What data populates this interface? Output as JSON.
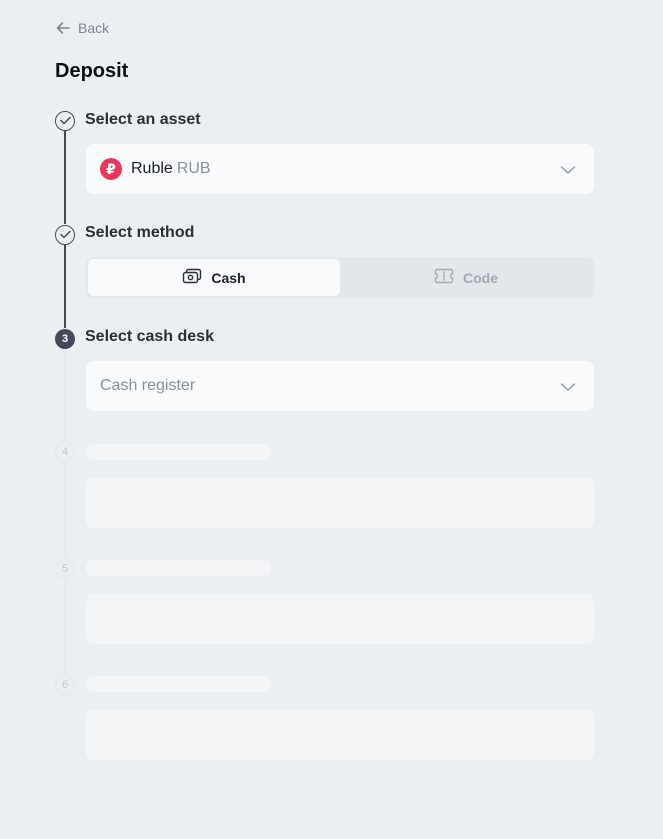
{
  "nav": {
    "back_label": "Back"
  },
  "page": {
    "title": "Deposit"
  },
  "steps": {
    "asset": {
      "label": "Select an asset",
      "currency_symbol": "₽",
      "asset_name": "Ruble",
      "asset_code": "RUB"
    },
    "method": {
      "label": "Select method",
      "options": [
        {
          "label": "Cash",
          "selected": true
        },
        {
          "label": "Code",
          "selected": false
        }
      ]
    },
    "cash_desk": {
      "number": "3",
      "label": "Select cash desk",
      "placeholder": "Cash register"
    },
    "pending": [
      {
        "number": "4"
      },
      {
        "number": "5"
      },
      {
        "number": "6"
      }
    ]
  },
  "colors": {
    "background": "#eceff2",
    "card": "#f9fafb",
    "step_active": "#454958",
    "ruble_brand": "#e8375a",
    "muted_text": "#8a8f9c"
  },
  "icons": {
    "back": "arrow-left-icon",
    "done": "check-icon",
    "dropdown": "chevron-down-icon",
    "cash": "banknotes-icon",
    "code": "voucher-code-icon"
  }
}
